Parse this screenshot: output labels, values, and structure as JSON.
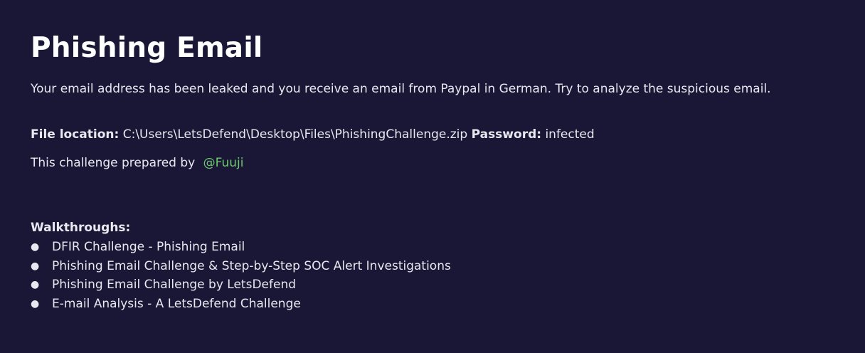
{
  "title": "Phishing Email",
  "description": "Your email address has been leaked and you receive an email from Paypal in German. Try to analyze the suspicious email.",
  "file_location": {
    "label": "File location:",
    "value": "C:\\Users\\LetsDefend\\Desktop\\Files\\PhishingChallenge.zip",
    "password_label": "Password:",
    "password_value": "infected"
  },
  "prepared_by": {
    "text": "This challenge prepared by",
    "author": "@Fuuji"
  },
  "walkthroughs": {
    "heading": "Walkthroughs:",
    "items": [
      "DFIR Challenge - Phishing Email",
      "Phishing Email Challenge & Step-by-Step SOC Alert Investigations",
      "Phishing Email Challenge by LetsDefend",
      "E-mail Analysis - A LetsDefend Challenge"
    ],
    "bullet": "●"
  },
  "colors": {
    "background": "#1a1736",
    "text": "#e8e8f0",
    "link_green": "#6cc86c"
  }
}
